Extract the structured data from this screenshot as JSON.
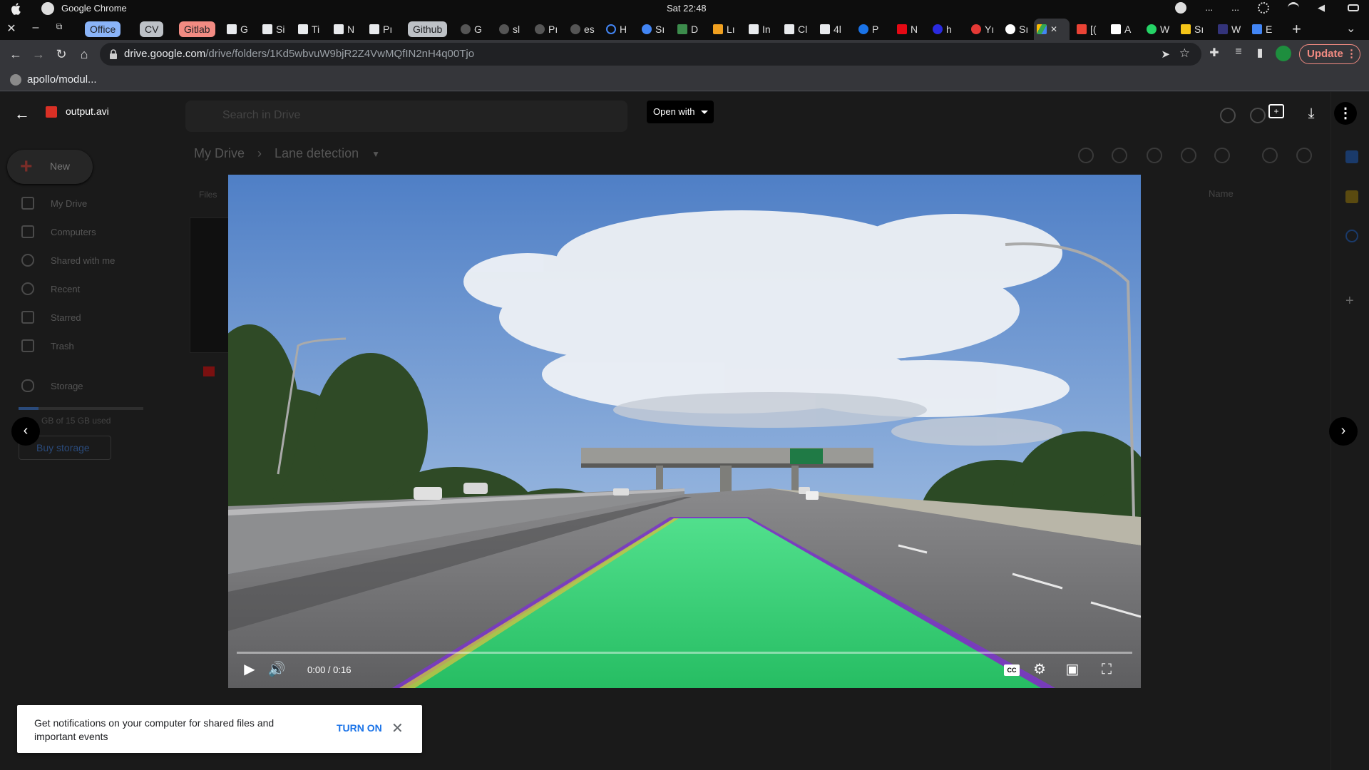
{
  "os": {
    "app_name": "Google Chrome",
    "clock": "Sat 22:48",
    "tray_ellipsis": "..."
  },
  "tabs": [
    {
      "label": "Office",
      "type": "group",
      "color": "#8ab4f8"
    },
    {
      "label": "CV",
      "type": "group",
      "color": "#bdc1c6"
    },
    {
      "label": "Gitlab",
      "type": "group",
      "color": "#f28b82"
    },
    {
      "label": "G"
    },
    {
      "label": "Si"
    },
    {
      "label": "Ti"
    },
    {
      "label": "N"
    },
    {
      "label": "Pı"
    },
    {
      "label": "Github",
      "type": "group",
      "color": "#bdc1c6"
    },
    {
      "label": "G"
    },
    {
      "label": "sl"
    },
    {
      "label": "Pı"
    },
    {
      "label": "es"
    },
    {
      "label": "H"
    },
    {
      "label": "Sı"
    },
    {
      "label": "D"
    },
    {
      "label": "Lı"
    },
    {
      "label": "In"
    },
    {
      "label": "Cl"
    },
    {
      "label": "4l"
    },
    {
      "label": "P"
    },
    {
      "label": "N"
    },
    {
      "label": "h"
    },
    {
      "label": "Yı"
    },
    {
      "label": "Sı"
    },
    {
      "label": "",
      "active": true
    },
    {
      "label": "[("
    },
    {
      "label": "A"
    },
    {
      "label": "W"
    },
    {
      "label": "Sı"
    },
    {
      "label": "W"
    },
    {
      "label": "E"
    }
  ],
  "address_bar": {
    "host": "drive.google.com",
    "path": "/drive/folders/1Kd5wbvuW9bjR2Z4VwMQfIN2nH4q00Tjo",
    "update_label": "Update"
  },
  "bookmarks": [
    {
      "label": "apollo/modul..."
    }
  ],
  "viewer": {
    "file_name": "output.avi",
    "open_with_label": "Open with",
    "more_glyph": "⋮",
    "prev_glyph": "‹",
    "next_glyph": "›"
  },
  "drive": {
    "search_placeholder": "Search in Drive",
    "new_label": "New",
    "sidebar": [
      {
        "label": "My Drive",
        "icon": "drive-icon"
      },
      {
        "label": "Computers",
        "icon": "computer-icon"
      },
      {
        "label": "Shared with me",
        "icon": "people-icon"
      },
      {
        "label": "Recent",
        "icon": "clock-icon"
      },
      {
        "label": "Starred",
        "icon": "star-icon"
      },
      {
        "label": "Trash",
        "icon": "trash-icon"
      }
    ],
    "storage_label": "Storage",
    "storage_text": "GB of 15 GB used",
    "buy_storage_label": "Buy storage",
    "breadcrumb": [
      "My Drive",
      "Lane detection"
    ],
    "files_label": "Files",
    "sort_label": "Name"
  },
  "video": {
    "time": "0:00 / 0:16",
    "progress": 0.0,
    "cc_label": "CC"
  },
  "toast": {
    "message": "Get notifications on your computer for shared files and important events",
    "action_label": "TURN ON"
  },
  "colors": {
    "lane_overlay": "#2ee87a",
    "accent_blue": "#1a73e8",
    "update_red": "#f28b82"
  }
}
